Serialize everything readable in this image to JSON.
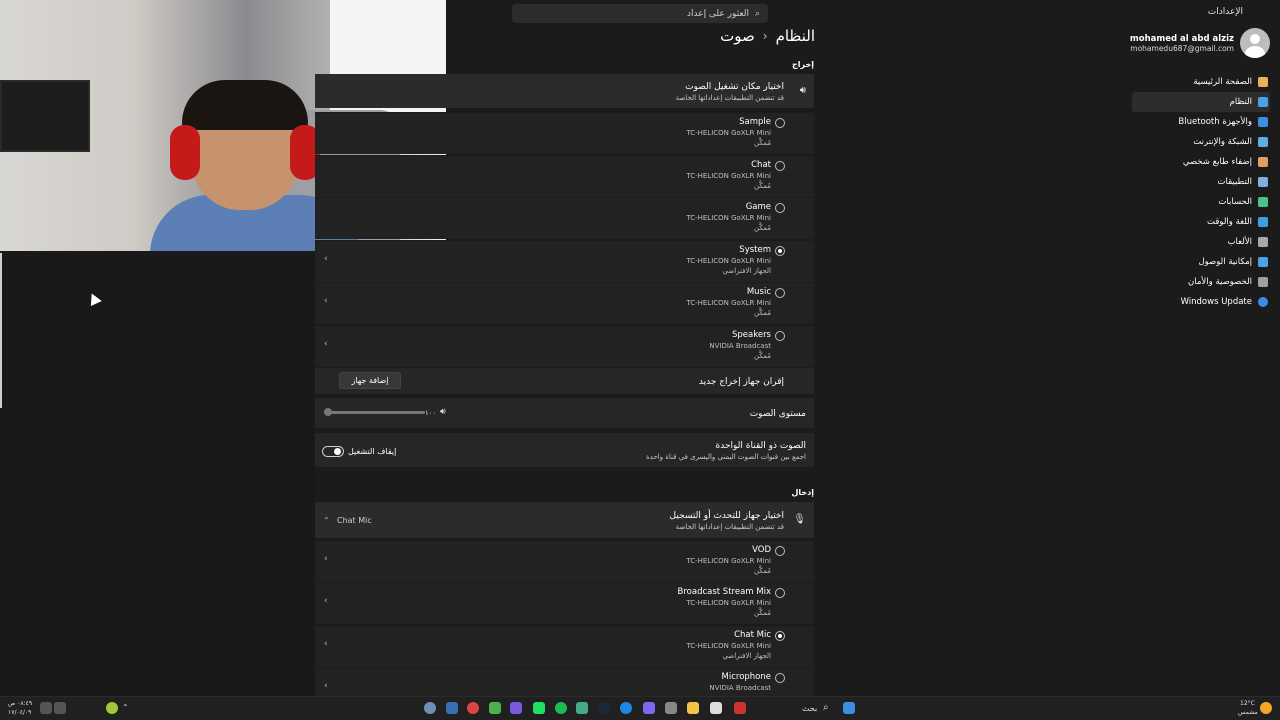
{
  "window": {
    "app_title": "الإعدادات"
  },
  "search": {
    "placeholder": "العثور على إعداد"
  },
  "breadcrumb": {
    "parent": "النظام",
    "current": "صوت"
  },
  "profile": {
    "name": "mohamed al abd alziz",
    "email": "mohamedu687@gmail.com"
  },
  "nav": {
    "items": [
      {
        "label": "الصفحة الرئيسية",
        "icon": "home-icon",
        "color": "#e8b15a"
      },
      {
        "label": "النظام",
        "icon": "monitor-icon",
        "color": "#4aa3e8",
        "active": true
      },
      {
        "label": "Bluetooth والأجهزة",
        "icon": "bluetooth-icon",
        "color": "#3a8fe0"
      },
      {
        "label": "الشبكة والإنترنت",
        "icon": "wifi-icon",
        "color": "#5ab0e6"
      },
      {
        "label": "إضفاء طابع شخصي",
        "icon": "brush-icon",
        "color": "#e2a05c"
      },
      {
        "label": "التطبيقات",
        "icon": "apps-icon",
        "color": "#7fb0e0"
      },
      {
        "label": "الحسابات",
        "icon": "person-icon",
        "color": "#4cc28a"
      },
      {
        "label": "اللغة والوقت",
        "icon": "globe-clock-icon",
        "color": "#3f9fe0"
      },
      {
        "label": "الألعاب",
        "icon": "gamepad-icon",
        "color": "#a8a8a8"
      },
      {
        "label": "إمكانية الوصول",
        "icon": "accessibility-icon",
        "color": "#4aa3e8"
      },
      {
        "label": "الخصوصية والأمان",
        "icon": "shield-icon",
        "color": "#9aa0a6"
      },
      {
        "label": "Windows Update",
        "icon": "update-icon",
        "color": "#3a8fe0"
      }
    ]
  },
  "output": {
    "section_label": "إخراج",
    "choose_title": "اختيار مكان تشغيل الصوت",
    "choose_sub": "قد تتضمن التطبيقات إعداداتها الخاصة",
    "devices": [
      {
        "name": "Sample",
        "model": "TC-HELICON GoXLR Mini",
        "state": "مُمكَّن",
        "selected": false
      },
      {
        "name": "Chat",
        "model": "TC-HELICON GoXLR Mini",
        "state": "مُمكَّن",
        "selected": false
      },
      {
        "name": "Game",
        "model": "TC-HELICON GoXLR Mini",
        "state": "مُمكَّن",
        "selected": false
      },
      {
        "name": "System",
        "model": "TC-HELICON GoXLR Mini",
        "state": "الجهاز الافتراضي",
        "selected": true
      },
      {
        "name": "Music",
        "model": "TC-HELICON GoXLR Mini",
        "state": "مُمكَّن",
        "selected": false
      },
      {
        "name": "Speakers",
        "model": "NVIDIA Broadcast",
        "state": "مُمكَّن",
        "selected": false
      }
    ],
    "pair_label": "إقران جهاز إخراج جديد",
    "add_device": "إضافة جهاز",
    "volume_label": "مستوى الصوت",
    "volume_value": "١٠٠",
    "volume_level": 0,
    "mono_title": "الصوت ذو القناة الواحدة",
    "mono_sub": "اجمع بين قنوات الصوت اليمنى واليسرى في قناة واحدة",
    "mono_state": "إيقاف التشغيل"
  },
  "input": {
    "section_label": "إدخال",
    "choose_title": "اختيار جهاز للتحدث أو التسجيل",
    "choose_sub": "قد تتضمن التطبيقات إعداداتها الخاصة",
    "selected_device": "Chat Mic",
    "devices": [
      {
        "name": "VOD",
        "model": "TC-HELICON GoXLR Mini",
        "state": "مُمكَّن",
        "selected": false
      },
      {
        "name": "Broadcast Stream Mix",
        "model": "TC-HELICON GoXLR Mini",
        "state": "مُمكَّن",
        "selected": false
      },
      {
        "name": "Chat Mic",
        "model": "TC-HELICON GoXLR Mini",
        "state": "الجهاز الافتراضي",
        "selected": true
      },
      {
        "name": "Microphone",
        "model": "NVIDIA Broadcast",
        "state": "",
        "selected": false
      }
    ]
  },
  "taskbar": {
    "search_label": "بحث",
    "weather": "12°C",
    "weather_sub": "مشمس",
    "time": "٠٨:٤٩ ص",
    "date": "١٧/٠٤/٠٩"
  }
}
